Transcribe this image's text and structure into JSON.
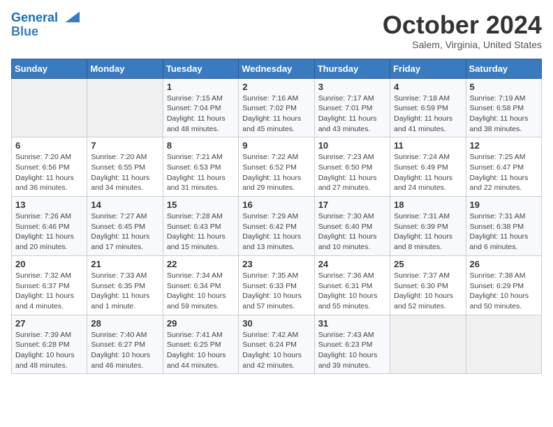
{
  "header": {
    "logo_line1": "General",
    "logo_line2": "Blue",
    "month": "October 2024",
    "location": "Salem, Virginia, United States"
  },
  "weekdays": [
    "Sunday",
    "Monday",
    "Tuesday",
    "Wednesday",
    "Thursday",
    "Friday",
    "Saturday"
  ],
  "weeks": [
    [
      {
        "day": "",
        "info": ""
      },
      {
        "day": "",
        "info": ""
      },
      {
        "day": "1",
        "info": "Sunrise: 7:15 AM\nSunset: 7:04 PM\nDaylight: 11 hours and 48 minutes."
      },
      {
        "day": "2",
        "info": "Sunrise: 7:16 AM\nSunset: 7:02 PM\nDaylight: 11 hours and 45 minutes."
      },
      {
        "day": "3",
        "info": "Sunrise: 7:17 AM\nSunset: 7:01 PM\nDaylight: 11 hours and 43 minutes."
      },
      {
        "day": "4",
        "info": "Sunrise: 7:18 AM\nSunset: 6:59 PM\nDaylight: 11 hours and 41 minutes."
      },
      {
        "day": "5",
        "info": "Sunrise: 7:19 AM\nSunset: 6:58 PM\nDaylight: 11 hours and 38 minutes."
      }
    ],
    [
      {
        "day": "6",
        "info": "Sunrise: 7:20 AM\nSunset: 6:56 PM\nDaylight: 11 hours and 36 minutes."
      },
      {
        "day": "7",
        "info": "Sunrise: 7:20 AM\nSunset: 6:55 PM\nDaylight: 11 hours and 34 minutes."
      },
      {
        "day": "8",
        "info": "Sunrise: 7:21 AM\nSunset: 6:53 PM\nDaylight: 11 hours and 31 minutes."
      },
      {
        "day": "9",
        "info": "Sunrise: 7:22 AM\nSunset: 6:52 PM\nDaylight: 11 hours and 29 minutes."
      },
      {
        "day": "10",
        "info": "Sunrise: 7:23 AM\nSunset: 6:50 PM\nDaylight: 11 hours and 27 minutes."
      },
      {
        "day": "11",
        "info": "Sunrise: 7:24 AM\nSunset: 6:49 PM\nDaylight: 11 hours and 24 minutes."
      },
      {
        "day": "12",
        "info": "Sunrise: 7:25 AM\nSunset: 6:47 PM\nDaylight: 11 hours and 22 minutes."
      }
    ],
    [
      {
        "day": "13",
        "info": "Sunrise: 7:26 AM\nSunset: 6:46 PM\nDaylight: 11 hours and 20 minutes."
      },
      {
        "day": "14",
        "info": "Sunrise: 7:27 AM\nSunset: 6:45 PM\nDaylight: 11 hours and 17 minutes."
      },
      {
        "day": "15",
        "info": "Sunrise: 7:28 AM\nSunset: 6:43 PM\nDaylight: 11 hours and 15 minutes."
      },
      {
        "day": "16",
        "info": "Sunrise: 7:29 AM\nSunset: 6:42 PM\nDaylight: 11 hours and 13 minutes."
      },
      {
        "day": "17",
        "info": "Sunrise: 7:30 AM\nSunset: 6:40 PM\nDaylight: 11 hours and 10 minutes."
      },
      {
        "day": "18",
        "info": "Sunrise: 7:31 AM\nSunset: 6:39 PM\nDaylight: 11 hours and 8 minutes."
      },
      {
        "day": "19",
        "info": "Sunrise: 7:31 AM\nSunset: 6:38 PM\nDaylight: 11 hours and 6 minutes."
      }
    ],
    [
      {
        "day": "20",
        "info": "Sunrise: 7:32 AM\nSunset: 6:37 PM\nDaylight: 11 hours and 4 minutes."
      },
      {
        "day": "21",
        "info": "Sunrise: 7:33 AM\nSunset: 6:35 PM\nDaylight: 11 hours and 1 minute."
      },
      {
        "day": "22",
        "info": "Sunrise: 7:34 AM\nSunset: 6:34 PM\nDaylight: 10 hours and 59 minutes."
      },
      {
        "day": "23",
        "info": "Sunrise: 7:35 AM\nSunset: 6:33 PM\nDaylight: 10 hours and 57 minutes."
      },
      {
        "day": "24",
        "info": "Sunrise: 7:36 AM\nSunset: 6:31 PM\nDaylight: 10 hours and 55 minutes."
      },
      {
        "day": "25",
        "info": "Sunrise: 7:37 AM\nSunset: 6:30 PM\nDaylight: 10 hours and 52 minutes."
      },
      {
        "day": "26",
        "info": "Sunrise: 7:38 AM\nSunset: 6:29 PM\nDaylight: 10 hours and 50 minutes."
      }
    ],
    [
      {
        "day": "27",
        "info": "Sunrise: 7:39 AM\nSunset: 6:28 PM\nDaylight: 10 hours and 48 minutes."
      },
      {
        "day": "28",
        "info": "Sunrise: 7:40 AM\nSunset: 6:27 PM\nDaylight: 10 hours and 46 minutes."
      },
      {
        "day": "29",
        "info": "Sunrise: 7:41 AM\nSunset: 6:25 PM\nDaylight: 10 hours and 44 minutes."
      },
      {
        "day": "30",
        "info": "Sunrise: 7:42 AM\nSunset: 6:24 PM\nDaylight: 10 hours and 42 minutes."
      },
      {
        "day": "31",
        "info": "Sunrise: 7:43 AM\nSunset: 6:23 PM\nDaylight: 10 hours and 39 minutes."
      },
      {
        "day": "",
        "info": ""
      },
      {
        "day": "",
        "info": ""
      }
    ]
  ]
}
